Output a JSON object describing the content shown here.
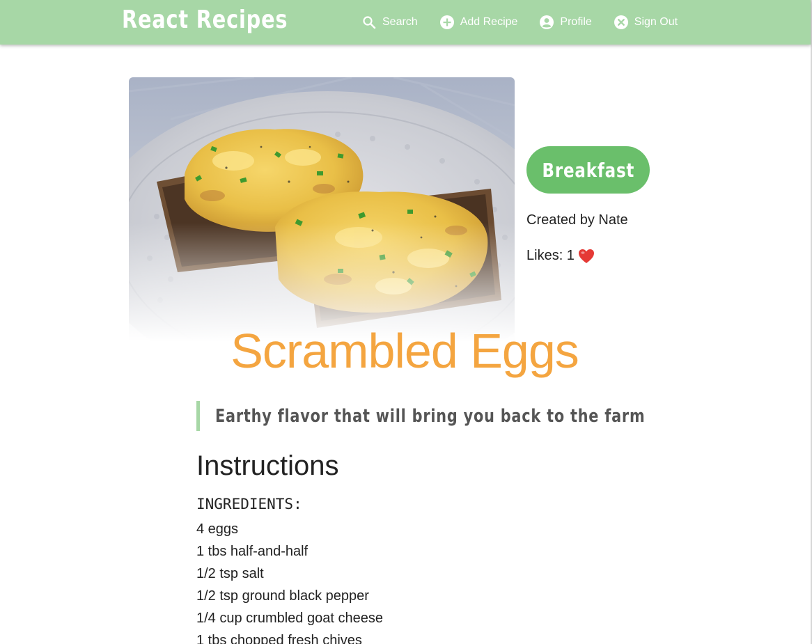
{
  "header": {
    "brand": "React Recipes",
    "nav": [
      {
        "label": "Search",
        "icon": "search-icon"
      },
      {
        "label": "Add Recipe",
        "icon": "add-circle-icon"
      },
      {
        "label": "Profile",
        "icon": "account-circle-icon"
      },
      {
        "label": "Sign Out",
        "icon": "cancel-circle-icon"
      }
    ]
  },
  "recipe": {
    "category": "Breakfast",
    "created_by": "Created by Nate",
    "likes_label": "Likes: 1",
    "likes_icon": "heart-icon",
    "title": "Scrambled Eggs",
    "description": "Earthy flavor that will bring you back to the farm",
    "instructions_heading": "Instructions",
    "ingredients_label": "INGREDIENTS:",
    "ingredients": [
      "4 eggs",
      "1 tbs half-and-half",
      "1/2 tsp salt",
      "1/2 tsp ground black pepper",
      "1/4 cup crumbled goat cheese",
      "1 tbs chopped fresh chives"
    ]
  },
  "colors": {
    "header_bg": "#a7d7a6",
    "badge_bg": "#6abf6b",
    "title": "#f4a540",
    "quote_border": "#a7d7a6",
    "heart": "#e53935"
  }
}
